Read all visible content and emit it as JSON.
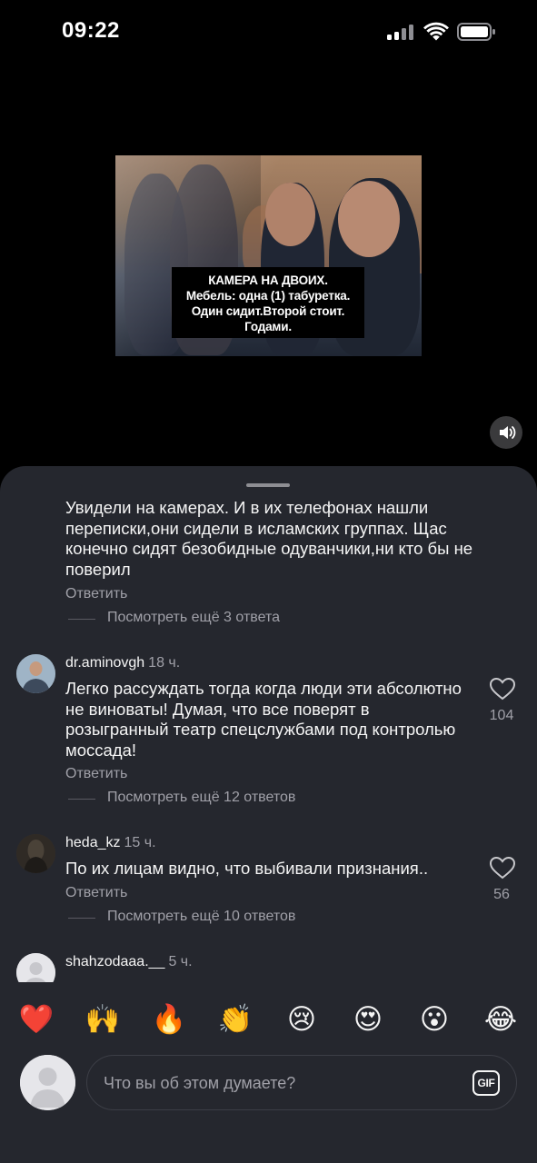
{
  "status_bar": {
    "time": "09:22"
  },
  "media": {
    "meme_lines": [
      "КАМЕРА НА ДВОИХ.",
      "Мебель: одна (1) табуретка.",
      "Один сидит.Второй стоит.",
      "Годами."
    ]
  },
  "comments": [
    {
      "text": "Увидели на камерах. И в их телефонах нашли переписки,они сидели в исламских группах. Щас конечно сидят безобидные одуванчики,ни кто бы не поверил",
      "reply_label": "Ответить",
      "more_label": "Посмотреть ещё 3 ответа"
    },
    {
      "username": "dr.aminovgh",
      "time": "18 ч.",
      "text": "Легко рассуждать тогда когда люди эти абсолютно не виноваты! Думая, что все поверят в розыгранный театр спецслужбами под контролью моссада!",
      "likes": "104",
      "reply_label": "Ответить",
      "more_label": "Посмотреть ещё 12 ответов"
    },
    {
      "username": "heda_kz",
      "time": "15 ч.",
      "text": "По их лицам видно, что выбивали признания..",
      "likes": "56",
      "reply_label": "Ответить",
      "more_label": "Посмотреть ещё 10 ответов"
    },
    {
      "username": "shahzodaaa.__",
      "time": "5 ч."
    }
  ],
  "reactions": [
    "❤️",
    "🙌",
    "🔥",
    "👏",
    "😢",
    "😍",
    "😮",
    "😂"
  ],
  "composer": {
    "placeholder": "Что вы об этом думаете?",
    "gif_label": "GIF"
  }
}
